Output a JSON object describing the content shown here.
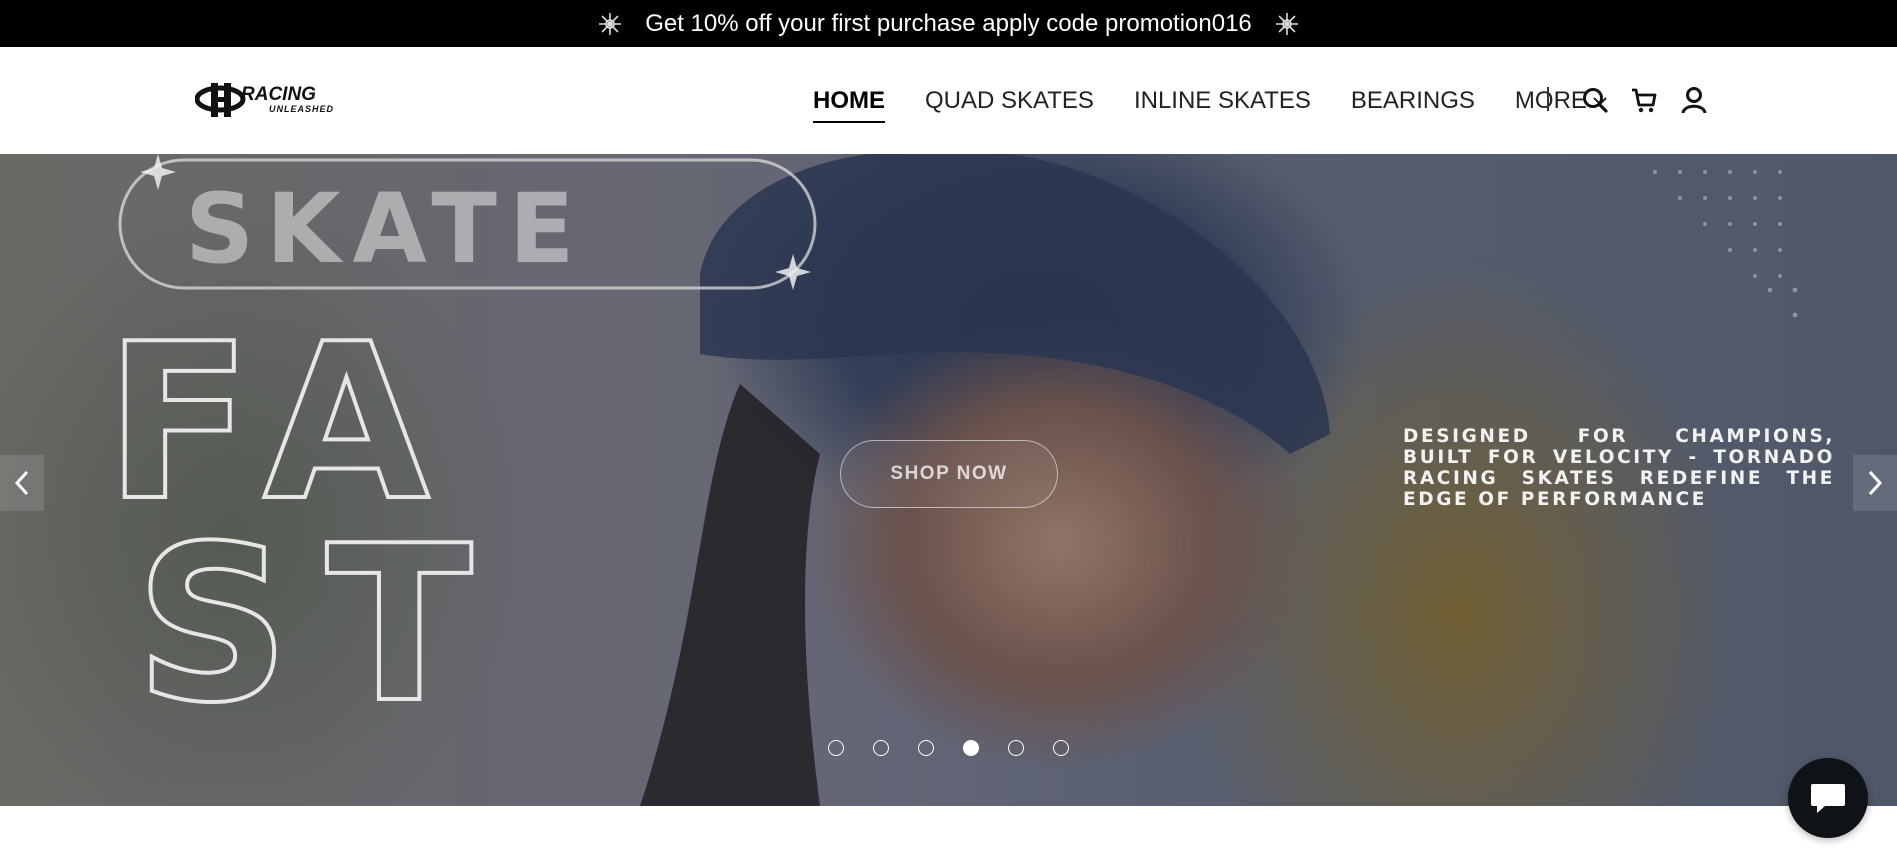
{
  "announcement": {
    "text": "Get 10% off your first purchase apply code promotion016",
    "icon": "sparkle-burst-icon"
  },
  "header": {
    "logo": {
      "main": "RACING",
      "sub": "UNLEASHED"
    },
    "nav": [
      {
        "label": "HOME",
        "active": true
      },
      {
        "label": "QUAD SKATES",
        "active": false
      },
      {
        "label": "INLINE SKATES",
        "active": false
      },
      {
        "label": "BEARINGS",
        "active": false
      },
      {
        "label": "MORE",
        "active": false
      }
    ],
    "icons": [
      "search-icon",
      "cart-icon",
      "user-icon"
    ]
  },
  "hero": {
    "headline_top": "SKATE",
    "headline_row1": "FA",
    "headline_row2": "ST",
    "cta_label": "SHOP NOW",
    "tagline": "DESIGNED FOR CHAMPIONS, BUILT FOR VELOCITY - TORNADO RACING SKATES REDEFINE THE EDGE OF PERFORMANCE",
    "slides_total": 6,
    "active_slide": 4
  },
  "chat": {
    "icon": "chat-bubble-icon"
  },
  "colors": {
    "announcement_bg": "#000000",
    "chat_bg": "#0f1216",
    "text": "#222222"
  }
}
